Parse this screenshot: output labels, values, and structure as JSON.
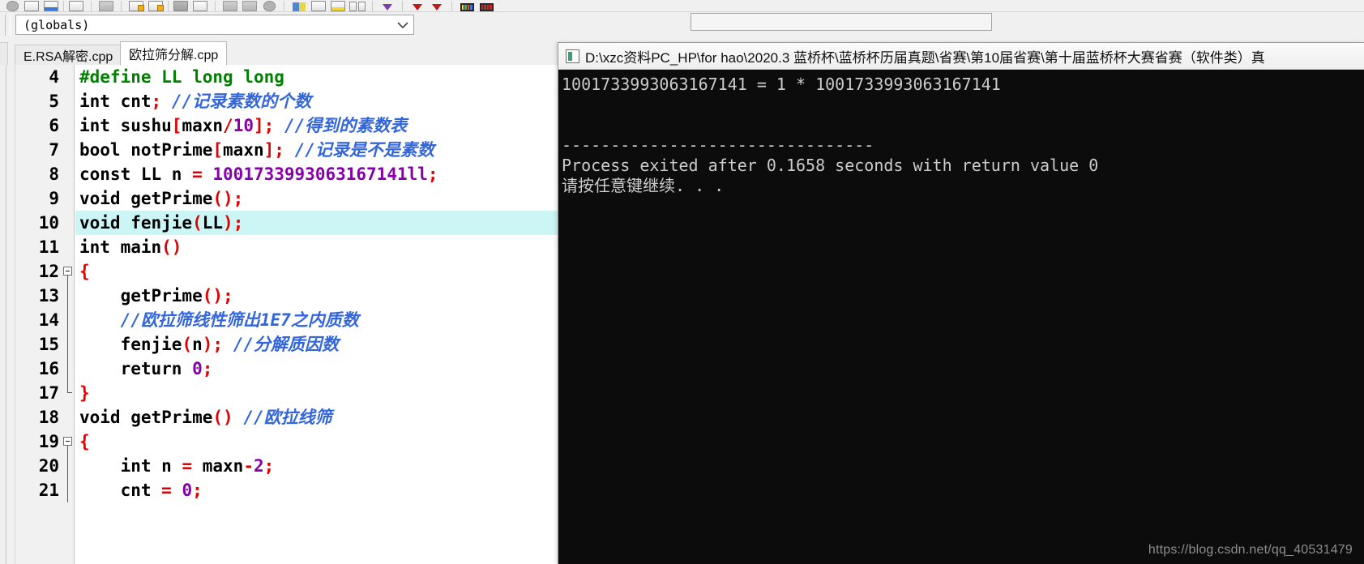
{
  "toolbar": {
    "groups": [
      {
        "name": "file-group",
        "buttons": [
          "new-file-icon",
          "open-file-icon",
          "save-file-icon",
          "save-all-icon"
        ]
      },
      {
        "name": "print-group",
        "buttons": [
          "print-icon"
        ]
      },
      {
        "name": "edit-group",
        "buttons": [
          "undo-icon",
          "redo-icon",
          "cut-icon",
          "copy-icon"
        ]
      },
      {
        "name": "project-group",
        "buttons": [
          "new-project-icon",
          "close-project-icon",
          "compile-icon",
          "run-icon"
        ]
      },
      {
        "name": "build-group",
        "buttons": [
          "compile-run-icon",
          "rebuild-all-icon",
          "syntax-check-icon",
          "profile-icon"
        ]
      },
      {
        "name": "debug-group",
        "buttons": [
          "debug-icon"
        ]
      },
      {
        "name": "breakpoint-group",
        "buttons": [
          "step-into-icon",
          "step-over-icon"
        ]
      },
      {
        "name": "window-group",
        "buttons": [
          "compiler-log-icon",
          "resources-icon"
        ]
      }
    ]
  },
  "scope_bar": {
    "globals_value": "(globals)",
    "right_combo_value": ""
  },
  "tabs": [
    {
      "label": "E.RSA解密.cpp",
      "active": false
    },
    {
      "label": "欧拉筛分解.cpp",
      "active": true
    }
  ],
  "editor": {
    "lines": [
      {
        "num": "4",
        "fold": "none",
        "tokens": [
          {
            "t": "#define ",
            "c": "t-prep"
          },
          {
            "t": "LL long long",
            "c": "t-prep"
          }
        ]
      },
      {
        "num": "5",
        "fold": "none",
        "tokens": [
          {
            "t": "int",
            "c": "t-kw"
          },
          {
            "t": " cnt",
            "c": "t-id"
          },
          {
            "t": ";",
            "c": "t-sym"
          },
          {
            "t": " ",
            "c": "t-id"
          },
          {
            "t": "//记录素数的个数",
            "c": "t-cm"
          }
        ]
      },
      {
        "num": "6",
        "fold": "none",
        "tokens": [
          {
            "t": "int",
            "c": "t-kw"
          },
          {
            "t": " sushu",
            "c": "t-id"
          },
          {
            "t": "[",
            "c": "t-sym"
          },
          {
            "t": "maxn",
            "c": "t-id"
          },
          {
            "t": "/",
            "c": "t-sym"
          },
          {
            "t": "10",
            "c": "t-num"
          },
          {
            "t": "];",
            "c": "t-sym"
          },
          {
            "t": " ",
            "c": "t-id"
          },
          {
            "t": "//得到的素数表",
            "c": "t-cm"
          }
        ]
      },
      {
        "num": "7",
        "fold": "none",
        "tokens": [
          {
            "t": "bool",
            "c": "t-kw"
          },
          {
            "t": " notPrime",
            "c": "t-id"
          },
          {
            "t": "[",
            "c": "t-sym"
          },
          {
            "t": "maxn",
            "c": "t-id"
          },
          {
            "t": "];",
            "c": "t-sym"
          },
          {
            "t": " ",
            "c": "t-id"
          },
          {
            "t": "//记录是不是素数",
            "c": "t-cm"
          }
        ]
      },
      {
        "num": "8",
        "fold": "none",
        "tokens": [
          {
            "t": "const",
            "c": "t-kw"
          },
          {
            "t": " LL n ",
            "c": "t-id"
          },
          {
            "t": "=",
            "c": "t-sym"
          },
          {
            "t": " ",
            "c": "t-id"
          },
          {
            "t": "1001733993063167141ll",
            "c": "t-num"
          },
          {
            "t": ";",
            "c": "t-sym"
          }
        ]
      },
      {
        "num": "9",
        "fold": "none",
        "tokens": [
          {
            "t": "void",
            "c": "t-kw"
          },
          {
            "t": " getPrime",
            "c": "t-id"
          },
          {
            "t": "();",
            "c": "t-sym"
          }
        ]
      },
      {
        "num": "10",
        "fold": "none",
        "highlight": true,
        "tokens": [
          {
            "t": "void",
            "c": "t-kw"
          },
          {
            "t": " fenjie",
            "c": "t-id"
          },
          {
            "t": "(",
            "c": "t-sym"
          },
          {
            "t": "LL",
            "c": "t-id"
          },
          {
            "t": ");",
            "c": "t-sym"
          }
        ]
      },
      {
        "num": "11",
        "fold": "none",
        "tokens": [
          {
            "t": "int",
            "c": "t-kw"
          },
          {
            "t": " main",
            "c": "t-id"
          },
          {
            "t": "()",
            "c": "t-sym"
          }
        ]
      },
      {
        "num": "12",
        "fold": "start",
        "tokens": [
          {
            "t": "{",
            "c": "t-sym"
          }
        ]
      },
      {
        "num": "13",
        "fold": "mid",
        "tokens": [
          {
            "t": "    getPrime",
            "c": "t-id"
          },
          {
            "t": "();",
            "c": "t-sym"
          }
        ]
      },
      {
        "num": "14",
        "fold": "mid",
        "tokens": [
          {
            "t": "    ",
            "c": "t-id"
          },
          {
            "t": "//欧拉筛线性筛出1E7之内质数",
            "c": "t-cm"
          }
        ]
      },
      {
        "num": "15",
        "fold": "mid",
        "tokens": [
          {
            "t": "    fenjie",
            "c": "t-id"
          },
          {
            "t": "(",
            "c": "t-sym"
          },
          {
            "t": "n",
            "c": "t-id"
          },
          {
            "t": ");",
            "c": "t-sym"
          },
          {
            "t": " ",
            "c": "t-id"
          },
          {
            "t": "//分解质因数",
            "c": "t-cm"
          }
        ]
      },
      {
        "num": "16",
        "fold": "mid",
        "tokens": [
          {
            "t": "    ",
            "c": "t-id"
          },
          {
            "t": "return",
            "c": "t-kw"
          },
          {
            "t": " ",
            "c": "t-id"
          },
          {
            "t": "0",
            "c": "t-num"
          },
          {
            "t": ";",
            "c": "t-sym"
          }
        ]
      },
      {
        "num": "17",
        "fold": "end",
        "tokens": [
          {
            "t": "}",
            "c": "t-sym"
          }
        ]
      },
      {
        "num": "18",
        "fold": "none",
        "tokens": [
          {
            "t": "void",
            "c": "t-kw"
          },
          {
            "t": " getPrime",
            "c": "t-id"
          },
          {
            "t": "()",
            "c": "t-sym"
          },
          {
            "t": " ",
            "c": "t-id"
          },
          {
            "t": "//欧拉线筛",
            "c": "t-cm"
          }
        ]
      },
      {
        "num": "19",
        "fold": "start",
        "tokens": [
          {
            "t": "{",
            "c": "t-sym"
          }
        ]
      },
      {
        "num": "20",
        "fold": "mid",
        "tokens": [
          {
            "t": "    ",
            "c": "t-id"
          },
          {
            "t": "int",
            "c": "t-kw"
          },
          {
            "t": " n ",
            "c": "t-id"
          },
          {
            "t": "=",
            "c": "t-sym"
          },
          {
            "t": " maxn",
            "c": "t-id"
          },
          {
            "t": "-",
            "c": "t-sym"
          },
          {
            "t": "2",
            "c": "t-num"
          },
          {
            "t": ";",
            "c": "t-sym"
          }
        ]
      },
      {
        "num": "21",
        "fold": "mid",
        "tokens": [
          {
            "t": "    cnt ",
            "c": "t-id"
          },
          {
            "t": "=",
            "c": "t-sym"
          },
          {
            "t": " ",
            "c": "t-id"
          },
          {
            "t": "0",
            "c": "t-num"
          },
          {
            "t": ";",
            "c": "t-sym"
          }
        ]
      }
    ]
  },
  "console": {
    "title": "D:\\xzc资料PC_HP\\for hao\\2020.3 蓝桥杯\\蓝桥杯历届真题\\省赛\\第10届省赛\\第十届蓝桥杯大赛省赛（软件类）真",
    "icon": "console-app-icon",
    "lines": [
      "1001733993063167141 = 1 * 1001733993063167141",
      "",
      "",
      "--------------------------------",
      "Process exited after 0.1658 seconds with return value 0",
      "请按任意键继续. . ."
    ]
  },
  "watermark": "https://blog.csdn.net/qq_40531479",
  "colors": {
    "highlight_line": "#ccf5f5",
    "comment": "#3366dd",
    "preprocessor": "#008000",
    "symbol": "#e00000",
    "number": "#8800aa",
    "console_bg": "#0c0c0c",
    "console_fg": "#cccccc"
  }
}
